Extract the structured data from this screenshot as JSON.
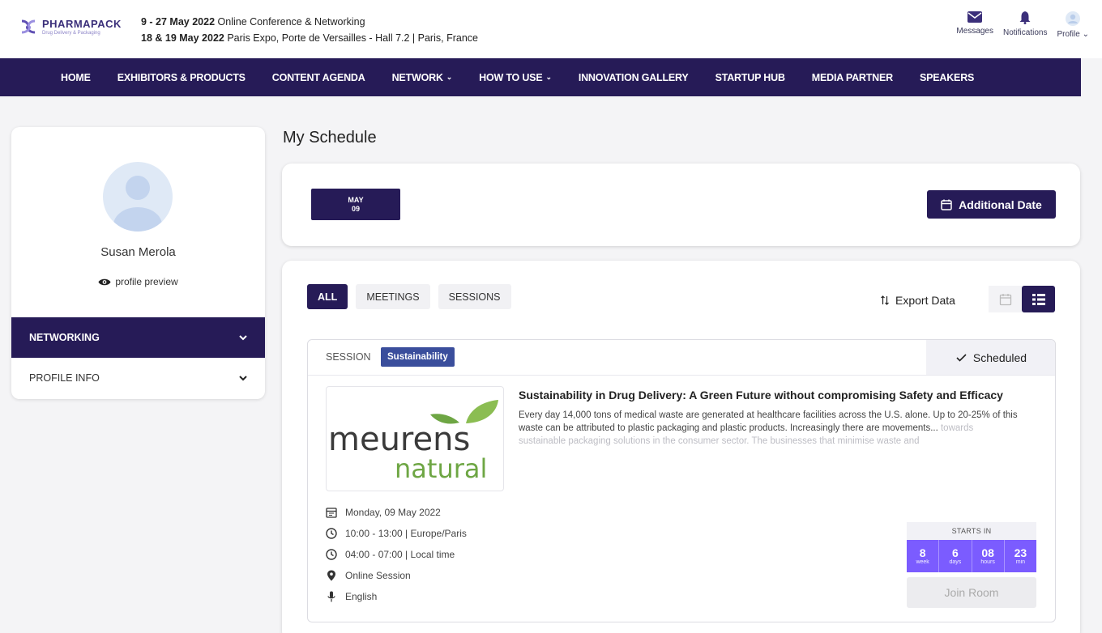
{
  "header": {
    "logo_name": "PHARMAPACK",
    "logo_sub": "Drug Delivery & Packaging",
    "event_line1_date": "9 - 27 May 2022",
    "event_line1_text": "Online Conference & Networking",
    "event_line2_date": "18 & 19 May 2022",
    "event_line2_text": "Paris Expo, Porte de Versailles - Hall 7.2 | Paris, France",
    "actions": {
      "messages": "Messages",
      "notifications": "Notifications",
      "profile": "Profile"
    }
  },
  "nav": {
    "home": "HOME",
    "exhibitors": "EXHIBITORS & PRODUCTS",
    "content_agenda": "CONTENT AGENDA",
    "network": "NETWORK",
    "how_to_use": "HOW TO USE",
    "innovation_gallery": "INNOVATION GALLERY",
    "startup_hub": "STARTUP HUB",
    "media_partner": "MEDIA PARTNER",
    "speakers": "SPEAKERS"
  },
  "sidebar": {
    "user_name": "Susan Merola",
    "profile_preview": "profile preview",
    "items": [
      {
        "label": "NETWORKING"
      },
      {
        "label": "PROFILE INFO"
      }
    ]
  },
  "main": {
    "title": "My Schedule",
    "date_chip": {
      "month": "MAY",
      "day": "09"
    },
    "additional_date": "Additional Date",
    "filters": {
      "all": "ALL",
      "meetings": "MEETINGS",
      "sessions": "SESSIONS"
    },
    "export": "Export Data"
  },
  "session": {
    "type": "SESSION",
    "tag": "Sustainability",
    "status": "Scheduled",
    "logo_word1": "meurens",
    "logo_word2": "natural",
    "title": "Sustainability in Drug Delivery: A Green Future without compromising Safety and Efficacy",
    "description": "Every day 14,000 tons of medical waste are generated at healthcare facilities across the U.S. alone. Up to 20-25% of this waste can be attributed to plastic packaging and plastic products. Increasingly there are movements...",
    "description_faded": "towards sustainable packaging solutions in the consumer sector. The businesses that minimise waste and",
    "date": "Monday, 09 May 2022",
    "time_local_event": "10:00 - 13:00 | Europe/Paris",
    "time_local": "04:00 - 07:00 | Local time",
    "location": "Online Session",
    "language": "English",
    "starts_in_label": "STARTS IN",
    "countdown": [
      {
        "num": "8",
        "unit": "week"
      },
      {
        "num": "6",
        "unit": "days"
      },
      {
        "num": "08",
        "unit": "hours"
      },
      {
        "num": "23",
        "unit": "min"
      }
    ],
    "join": "Join Room"
  },
  "colors": {
    "primary": "#261b57",
    "tag": "#3a4e9c",
    "countdown": "#7b5cff",
    "logo_green": "#6ea644"
  }
}
